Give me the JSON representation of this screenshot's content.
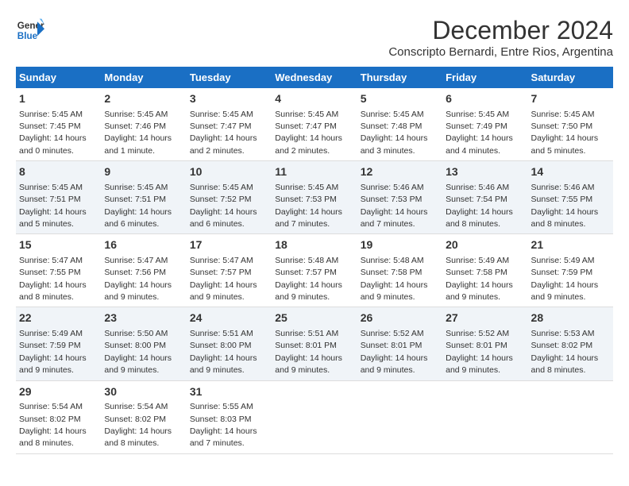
{
  "logo": {
    "line1": "General",
    "line2": "Blue"
  },
  "title": "December 2024",
  "location": "Conscripto Bernardi, Entre Rios, Argentina",
  "days_header": [
    "Sunday",
    "Monday",
    "Tuesday",
    "Wednesday",
    "Thursday",
    "Friday",
    "Saturday"
  ],
  "weeks": [
    [
      {
        "day": "1",
        "sunrise": "Sunrise: 5:45 AM",
        "sunset": "Sunset: 7:45 PM",
        "daylight": "Daylight: 14 hours and 0 minutes."
      },
      {
        "day": "2",
        "sunrise": "Sunrise: 5:45 AM",
        "sunset": "Sunset: 7:46 PM",
        "daylight": "Daylight: 14 hours and 1 minute."
      },
      {
        "day": "3",
        "sunrise": "Sunrise: 5:45 AM",
        "sunset": "Sunset: 7:47 PM",
        "daylight": "Daylight: 14 hours and 2 minutes."
      },
      {
        "day": "4",
        "sunrise": "Sunrise: 5:45 AM",
        "sunset": "Sunset: 7:47 PM",
        "daylight": "Daylight: 14 hours and 2 minutes."
      },
      {
        "day": "5",
        "sunrise": "Sunrise: 5:45 AM",
        "sunset": "Sunset: 7:48 PM",
        "daylight": "Daylight: 14 hours and 3 minutes."
      },
      {
        "day": "6",
        "sunrise": "Sunrise: 5:45 AM",
        "sunset": "Sunset: 7:49 PM",
        "daylight": "Daylight: 14 hours and 4 minutes."
      },
      {
        "day": "7",
        "sunrise": "Sunrise: 5:45 AM",
        "sunset": "Sunset: 7:50 PM",
        "daylight": "Daylight: 14 hours and 5 minutes."
      }
    ],
    [
      {
        "day": "8",
        "sunrise": "Sunrise: 5:45 AM",
        "sunset": "Sunset: 7:51 PM",
        "daylight": "Daylight: 14 hours and 5 minutes."
      },
      {
        "day": "9",
        "sunrise": "Sunrise: 5:45 AM",
        "sunset": "Sunset: 7:51 PM",
        "daylight": "Daylight: 14 hours and 6 minutes."
      },
      {
        "day": "10",
        "sunrise": "Sunrise: 5:45 AM",
        "sunset": "Sunset: 7:52 PM",
        "daylight": "Daylight: 14 hours and 6 minutes."
      },
      {
        "day": "11",
        "sunrise": "Sunrise: 5:45 AM",
        "sunset": "Sunset: 7:53 PM",
        "daylight": "Daylight: 14 hours and 7 minutes."
      },
      {
        "day": "12",
        "sunrise": "Sunrise: 5:46 AM",
        "sunset": "Sunset: 7:53 PM",
        "daylight": "Daylight: 14 hours and 7 minutes."
      },
      {
        "day": "13",
        "sunrise": "Sunrise: 5:46 AM",
        "sunset": "Sunset: 7:54 PM",
        "daylight": "Daylight: 14 hours and 8 minutes."
      },
      {
        "day": "14",
        "sunrise": "Sunrise: 5:46 AM",
        "sunset": "Sunset: 7:55 PM",
        "daylight": "Daylight: 14 hours and 8 minutes."
      }
    ],
    [
      {
        "day": "15",
        "sunrise": "Sunrise: 5:47 AM",
        "sunset": "Sunset: 7:55 PM",
        "daylight": "Daylight: 14 hours and 8 minutes."
      },
      {
        "day": "16",
        "sunrise": "Sunrise: 5:47 AM",
        "sunset": "Sunset: 7:56 PM",
        "daylight": "Daylight: 14 hours and 9 minutes."
      },
      {
        "day": "17",
        "sunrise": "Sunrise: 5:47 AM",
        "sunset": "Sunset: 7:57 PM",
        "daylight": "Daylight: 14 hours and 9 minutes."
      },
      {
        "day": "18",
        "sunrise": "Sunrise: 5:48 AM",
        "sunset": "Sunset: 7:57 PM",
        "daylight": "Daylight: 14 hours and 9 minutes."
      },
      {
        "day": "19",
        "sunrise": "Sunrise: 5:48 AM",
        "sunset": "Sunset: 7:58 PM",
        "daylight": "Daylight: 14 hours and 9 minutes."
      },
      {
        "day": "20",
        "sunrise": "Sunrise: 5:49 AM",
        "sunset": "Sunset: 7:58 PM",
        "daylight": "Daylight: 14 hours and 9 minutes."
      },
      {
        "day": "21",
        "sunrise": "Sunrise: 5:49 AM",
        "sunset": "Sunset: 7:59 PM",
        "daylight": "Daylight: 14 hours and 9 minutes."
      }
    ],
    [
      {
        "day": "22",
        "sunrise": "Sunrise: 5:49 AM",
        "sunset": "Sunset: 7:59 PM",
        "daylight": "Daylight: 14 hours and 9 minutes."
      },
      {
        "day": "23",
        "sunrise": "Sunrise: 5:50 AM",
        "sunset": "Sunset: 8:00 PM",
        "daylight": "Daylight: 14 hours and 9 minutes."
      },
      {
        "day": "24",
        "sunrise": "Sunrise: 5:51 AM",
        "sunset": "Sunset: 8:00 PM",
        "daylight": "Daylight: 14 hours and 9 minutes."
      },
      {
        "day": "25",
        "sunrise": "Sunrise: 5:51 AM",
        "sunset": "Sunset: 8:01 PM",
        "daylight": "Daylight: 14 hours and 9 minutes."
      },
      {
        "day": "26",
        "sunrise": "Sunrise: 5:52 AM",
        "sunset": "Sunset: 8:01 PM",
        "daylight": "Daylight: 14 hours and 9 minutes."
      },
      {
        "day": "27",
        "sunrise": "Sunrise: 5:52 AM",
        "sunset": "Sunset: 8:01 PM",
        "daylight": "Daylight: 14 hours and 9 minutes."
      },
      {
        "day": "28",
        "sunrise": "Sunrise: 5:53 AM",
        "sunset": "Sunset: 8:02 PM",
        "daylight": "Daylight: 14 hours and 8 minutes."
      }
    ],
    [
      {
        "day": "29",
        "sunrise": "Sunrise: 5:54 AM",
        "sunset": "Sunset: 8:02 PM",
        "daylight": "Daylight: 14 hours and 8 minutes."
      },
      {
        "day": "30",
        "sunrise": "Sunrise: 5:54 AM",
        "sunset": "Sunset: 8:02 PM",
        "daylight": "Daylight: 14 hours and 8 minutes."
      },
      {
        "day": "31",
        "sunrise": "Sunrise: 5:55 AM",
        "sunset": "Sunset: 8:03 PM",
        "daylight": "Daylight: 14 hours and 7 minutes."
      },
      {
        "day": "",
        "sunrise": "",
        "sunset": "",
        "daylight": ""
      },
      {
        "day": "",
        "sunrise": "",
        "sunset": "",
        "daylight": ""
      },
      {
        "day": "",
        "sunrise": "",
        "sunset": "",
        "daylight": ""
      },
      {
        "day": "",
        "sunrise": "",
        "sunset": "",
        "daylight": ""
      }
    ]
  ]
}
